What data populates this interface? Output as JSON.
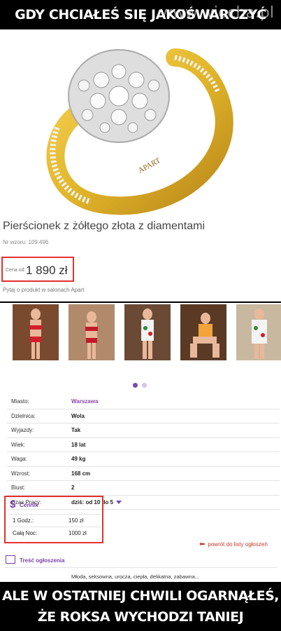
{
  "captions": {
    "top": "GDY CHCIAŁEŚ SIĘ JAKOŚWARCZYĆ",
    "watermark": "www.wiocha.pl",
    "bottom_line1": "ALE W OSTATNIEJ CHWILI OGARNĄŁEŚ,",
    "bottom_line2": "ŻE ROKSA WYCHODZI TANIEJ"
  },
  "ring": {
    "engraving": "APART",
    "title": "Pierścionek z żółtego złota z diamentami",
    "model_number": "Nr wzoru: 109.496",
    "price_label": "Cena od:",
    "price_value": "1 890 zł",
    "ask_text": "Pytaj o produkt w salonach Apart"
  },
  "listing": {
    "photo_count": 5,
    "carousel_pages": 2,
    "carousel_active": 1,
    "details": [
      {
        "label": "Miasto:",
        "value": "Warszawa"
      },
      {
        "label": "Dzielnica:",
        "value": "Wola"
      },
      {
        "label": "Wyjazdy:",
        "value": "Tak"
      },
      {
        "label": "Wiek:",
        "value": "18 lat"
      },
      {
        "label": "Waga:",
        "value": "49 kg"
      },
      {
        "label": "Wzrost:",
        "value": "168 cm"
      },
      {
        "label": "Biust:",
        "value": "2"
      },
      {
        "label": "Czas Pracy:",
        "value": "dziś: od 10 do 5"
      }
    ],
    "pricing": {
      "title": "Cennik",
      "rows": [
        {
          "label": "1 Godz.:",
          "value": "150 zł"
        },
        {
          "label": "Całą Noc:",
          "value": "1000 zł"
        }
      ]
    },
    "back_link": "powrót do listy ogłoszeń",
    "description_title": "Treść ogłoszenia",
    "description_text": "Młoda, seksowna, urocza, ciepła, delikatna, zabawna..."
  },
  "colors": {
    "highlight_red": "#e53030",
    "accent_purple": "#7a3fa8",
    "gold": "#e2b62a"
  }
}
